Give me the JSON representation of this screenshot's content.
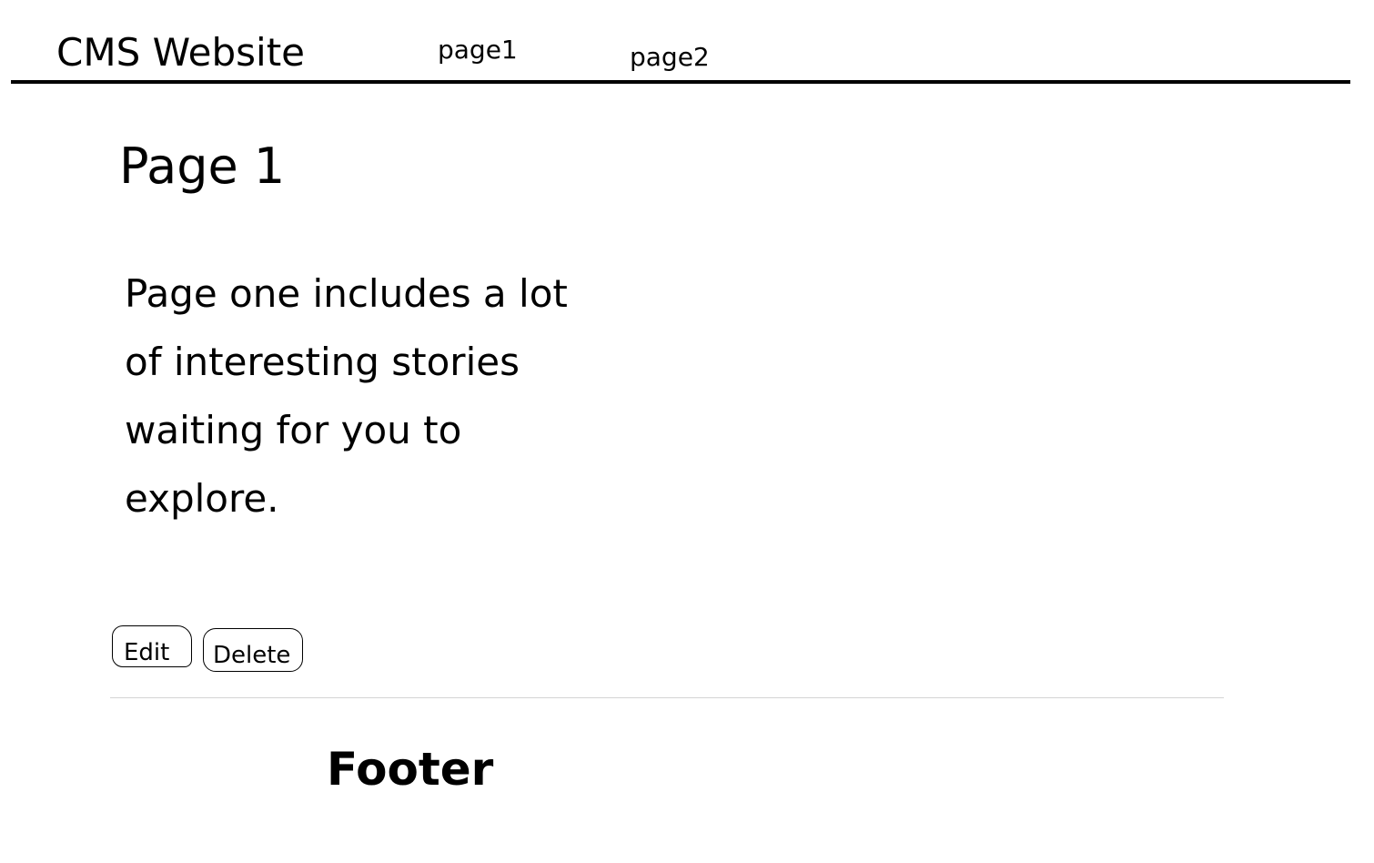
{
  "header": {
    "site_title": "CMS Website",
    "nav": [
      {
        "label": "page1"
      },
      {
        "label": "page2"
      }
    ]
  },
  "main": {
    "title": "Page 1",
    "body": "Page one includes a lot of interesting stories waiting for you to explore.",
    "actions": {
      "edit_label": "Edit",
      "delete_label": "Delete"
    }
  },
  "footer": {
    "title": "Footer"
  },
  "colors": {
    "text": "#000000",
    "background": "#ffffff",
    "header_rule": "#000000",
    "divider": "#d4d4d4"
  }
}
